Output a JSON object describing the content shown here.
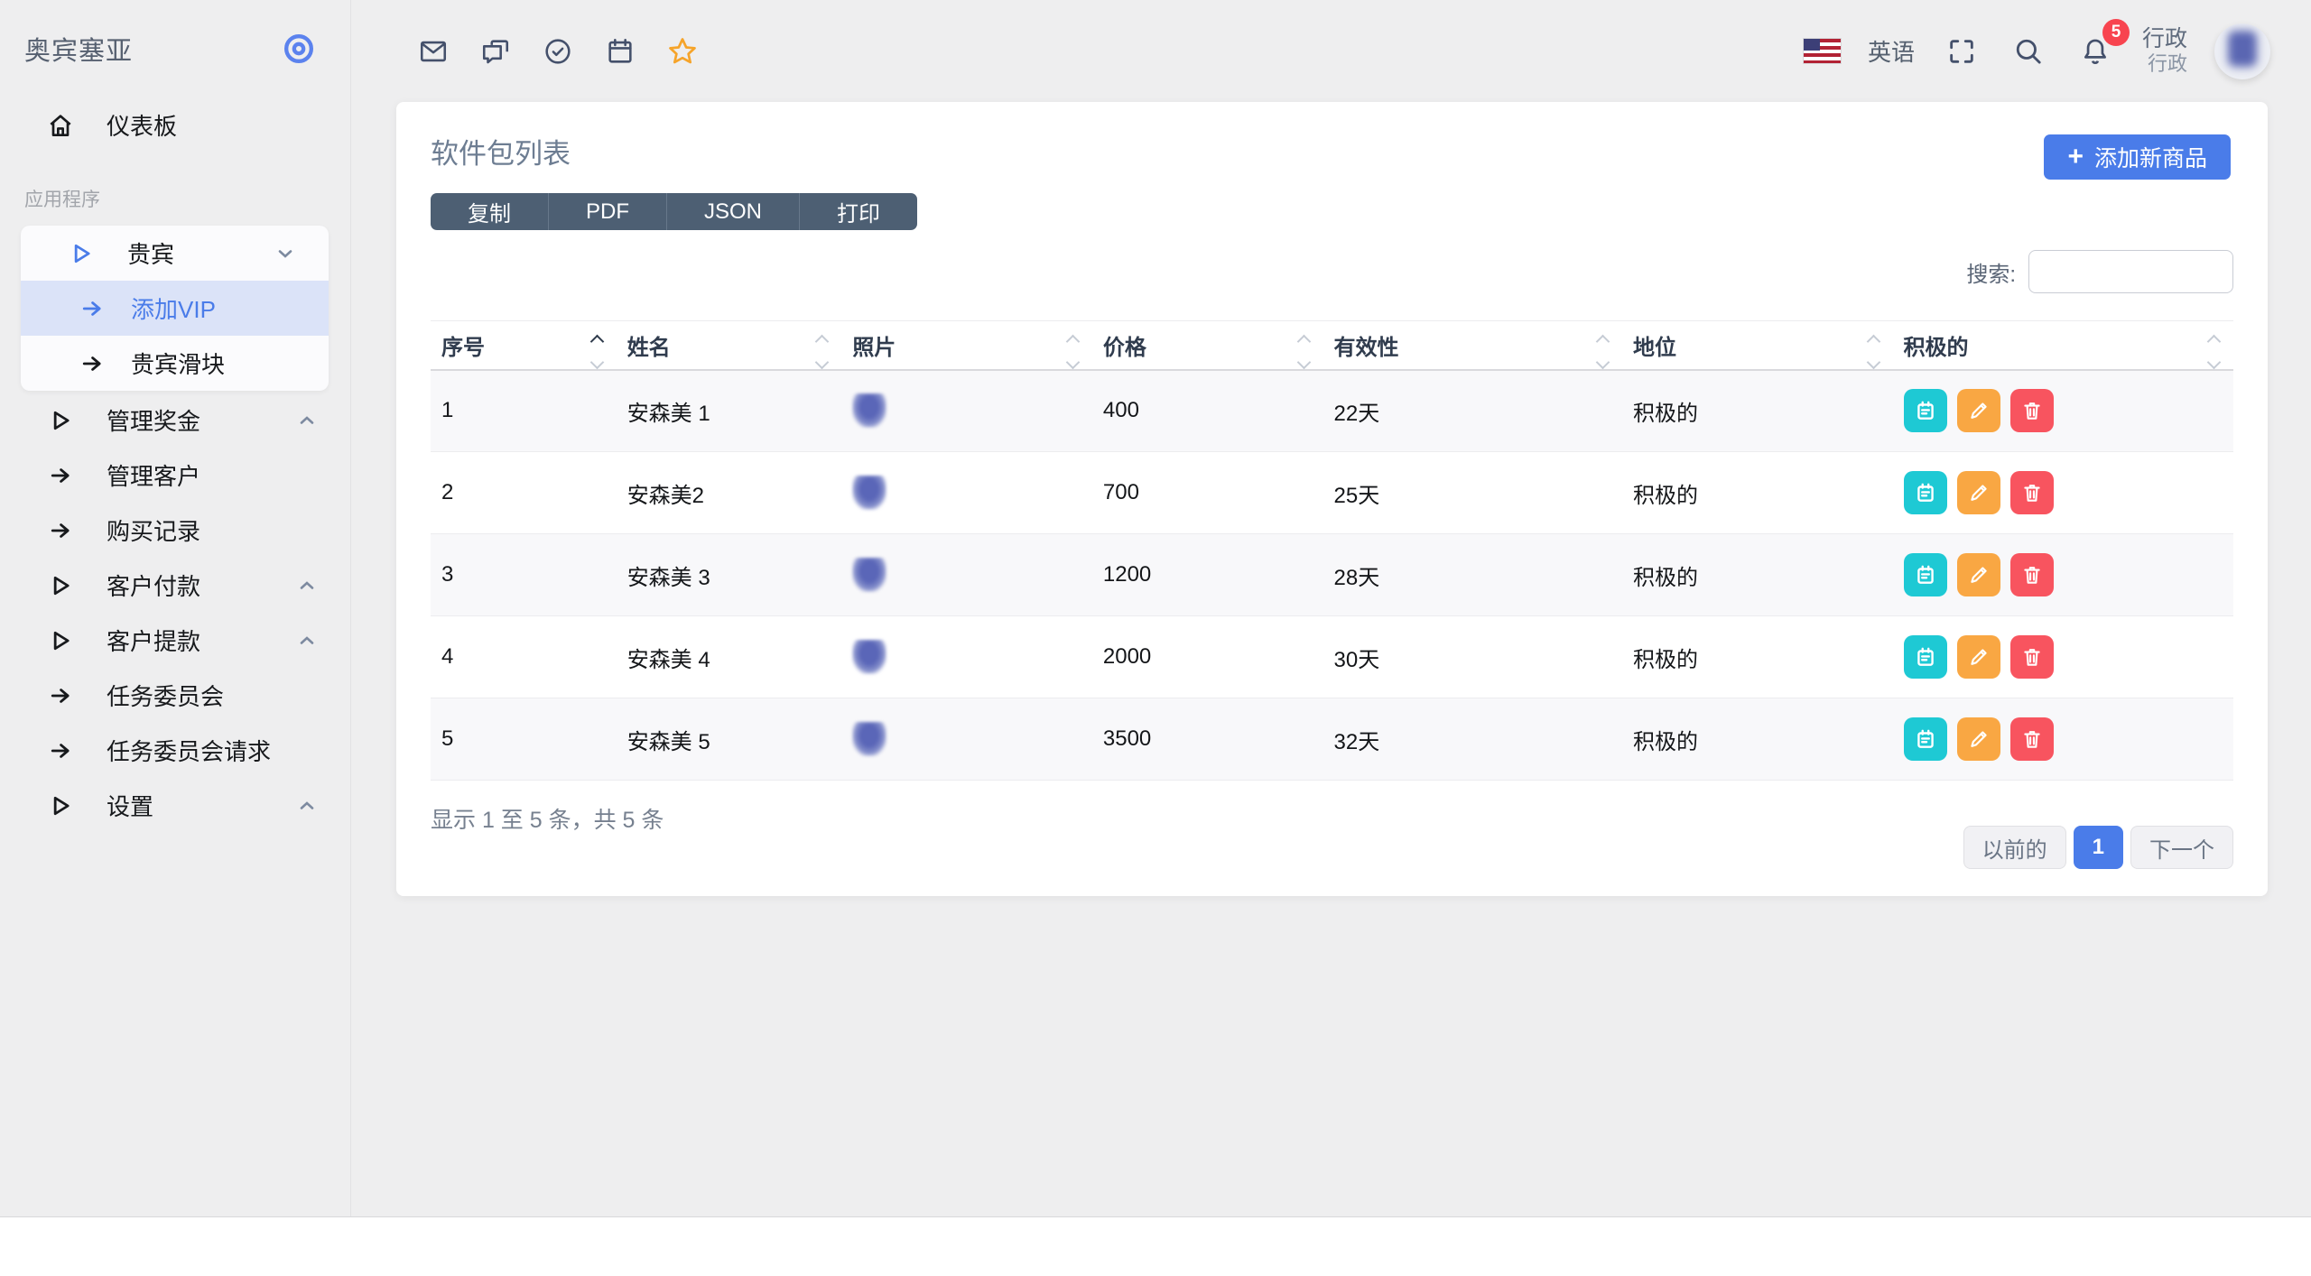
{
  "brand": {
    "title": "奥宾塞亚"
  },
  "sidebar": {
    "dashboard_label": "仪表板",
    "section_label": "应用程序",
    "vip_group": {
      "label": "贵宾",
      "children": [
        {
          "label": "添加VIP"
        },
        {
          "label": "贵宾滑块"
        }
      ]
    },
    "items": [
      {
        "label": "管理奖金"
      },
      {
        "label": "管理客户"
      },
      {
        "label": "购买记录"
      },
      {
        "label": "客户付款"
      },
      {
        "label": "客户提款"
      },
      {
        "label": "任务委员会"
      },
      {
        "label": "任务委员会请求"
      },
      {
        "label": "设置"
      }
    ]
  },
  "topbar": {
    "language": "英语",
    "notification_count": "5",
    "user_name": "行政",
    "user_role": "行政",
    "icon_names": [
      "mail-icon",
      "chat-icon",
      "check-circle-icon",
      "calendar-icon",
      "star-icon",
      "flag-us-icon",
      "fullscreen-icon",
      "search-icon",
      "bell-icon"
    ]
  },
  "card": {
    "title": "软件包列表",
    "export_buttons": [
      "复制",
      "PDF",
      "JSON",
      "打印"
    ],
    "add_plus": "+",
    "add_label": "添加新商品",
    "search_label": "搜索:"
  },
  "table": {
    "columns": [
      "序号",
      "姓名",
      "照片",
      "价格",
      "有效性",
      "地位",
      "积极的"
    ],
    "rows": [
      {
        "sn": "1",
        "name": "安森美 1",
        "price": "400",
        "validity": "22天",
        "status": "积极的"
      },
      {
        "sn": "2",
        "name": "安森美2",
        "price": "700",
        "validity": "25天",
        "status": "积极的"
      },
      {
        "sn": "3",
        "name": "安森美 3",
        "price": "1200",
        "validity": "28天",
        "status": "积极的"
      },
      {
        "sn": "4",
        "name": "安森美 4",
        "price": "2000",
        "validity": "30天",
        "status": "积极的"
      },
      {
        "sn": "5",
        "name": "安森美 5",
        "price": "3500",
        "validity": "32天",
        "status": "积极的"
      }
    ],
    "summary": "显示 1 至 5 条，共 5 条"
  },
  "pagination": {
    "previous": "以前的",
    "current": "1",
    "next": "下一个"
  },
  "colors": {
    "accent_blue": "#4a7ce9",
    "active_item_bg": "#dbe3f8",
    "dark_slate_button": "#4d5f73",
    "action_teal": "#1ec9d4",
    "action_orange": "#f9a743",
    "action_red": "#f8545f",
    "badge_red": "#f8444f",
    "star_orange": "#f6a42a",
    "page_bg": "#eeeeef"
  }
}
